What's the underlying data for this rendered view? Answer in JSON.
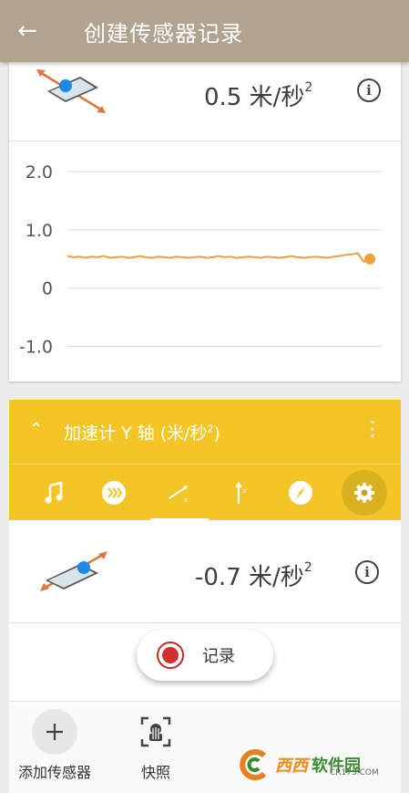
{
  "appbar": {
    "title": "创建传感器记录"
  },
  "sensor1": {
    "value": "0.5 米/秒",
    "unit_sup": "2"
  },
  "chart_data": {
    "type": "line",
    "title": "",
    "xlabel": "",
    "ylabel": "",
    "ylim": [
      -1.4,
      2.3
    ],
    "y_ticks": [
      "2.0",
      "1.0",
      "0",
      "-1.0"
    ],
    "y_tick_values": [
      2.0,
      1.0,
      0,
      -1.0
    ],
    "grid": true,
    "series": [
      {
        "color": "#e8a33d",
        "values": [
          0.55,
          0.53,
          0.54,
          0.52,
          0.54,
          0.53,
          0.55,
          0.52,
          0.53,
          0.54,
          0.52,
          0.53,
          0.55,
          0.53,
          0.52,
          0.54,
          0.53,
          0.52,
          0.54,
          0.53,
          0.52,
          0.53,
          0.54,
          0.52,
          0.53,
          0.55,
          0.53,
          0.54,
          0.52,
          0.53,
          0.54,
          0.53,
          0.52,
          0.54,
          0.53,
          0.52,
          0.53,
          0.55,
          0.53,
          0.52,
          0.53,
          0.54,
          0.53,
          0.52,
          0.54,
          0.55,
          0.57,
          0.58,
          0.6,
          0.45,
          0.5
        ]
      }
    ],
    "current_value": 0.5
  },
  "sensor2": {
    "title": "加速计 Y 轴 (米/秒",
    "title_sup": "2",
    "title_close": ")",
    "value": "-0.7 米/秒",
    "unit_sup": "2",
    "tabs": [
      "music-note-icon",
      "speed-icon",
      "acceleration-x-icon",
      "acceleration-y-icon",
      "compass-icon",
      "settings-icon"
    ]
  },
  "record": {
    "label": "记录"
  },
  "bottom_nav": {
    "add_label": "添加传感器",
    "snapshot_label": "快照"
  },
  "watermark": {
    "brand": "西西",
    "brand2": "软件园",
    "url": "CR173.COM"
  },
  "colors": {
    "appbar": "#b2a38f",
    "accent": "#f3c527",
    "line": "#e8a33d",
    "record": "#d32f2f"
  }
}
